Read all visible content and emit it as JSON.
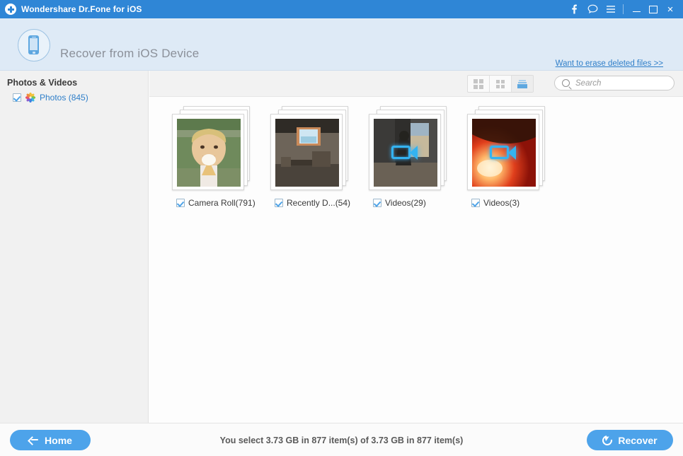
{
  "window": {
    "title": "Wondershare Dr.Fone for iOS",
    "logo_icon": "plus-circle-icon",
    "actions": [
      {
        "name": "facebook-icon",
        "glyph": "f"
      },
      {
        "name": "feedback-icon",
        "glyph": "○"
      },
      {
        "name": "menu-icon",
        "glyph": "≡"
      }
    ],
    "controls": {
      "minimize": "minimize-icon",
      "maximize": "maximize-icon",
      "close": "×"
    }
  },
  "header": {
    "device_icon": "iphone-icon",
    "title": "Recover from iOS Device",
    "erase_link": "Want to erase deleted files >>"
  },
  "sidebar": {
    "section_title": "Photos & Videos",
    "items": [
      {
        "label": "Photos (845)",
        "icon": "photos-app-icon",
        "checked": true
      }
    ]
  },
  "toolbar": {
    "view_modes": [
      {
        "name": "grid-large-view-button",
        "icon": "grid-large-icon",
        "active": false
      },
      {
        "name": "grid-small-view-button",
        "icon": "grid-small-icon",
        "active": false
      },
      {
        "name": "album-view-button",
        "icon": "album-stack-icon",
        "active": true
      }
    ],
    "search": {
      "placeholder": "Search",
      "value": "",
      "icon": "search-icon"
    }
  },
  "albums": [
    {
      "name": "Camera Roll(791)",
      "checked": true,
      "type": "photo",
      "thumb": "girl-eating-ice-cream"
    },
    {
      "name": "Recently D...(54)",
      "checked": true,
      "type": "photo",
      "thumb": "attic-room-skylight"
    },
    {
      "name": "Videos(29)",
      "checked": true,
      "type": "video",
      "thumb": "person-by-window"
    },
    {
      "name": "Videos(3)",
      "checked": true,
      "type": "video",
      "thumb": "red-sunset-flare"
    }
  ],
  "footer": {
    "home_button": "Home",
    "home_icon": "back-arrow-icon",
    "status": "You select 3.73 GB in 877 item(s) of 3.73 GB in 877 item(s)",
    "recover_button": "Recover",
    "recover_icon": "restore-icon"
  },
  "colors": {
    "titlebar": "#2f86d6",
    "header": "#deeaf6",
    "accent": "#4da3ea",
    "link": "#2f7fc9",
    "sidebar": "#f1f1f1"
  }
}
